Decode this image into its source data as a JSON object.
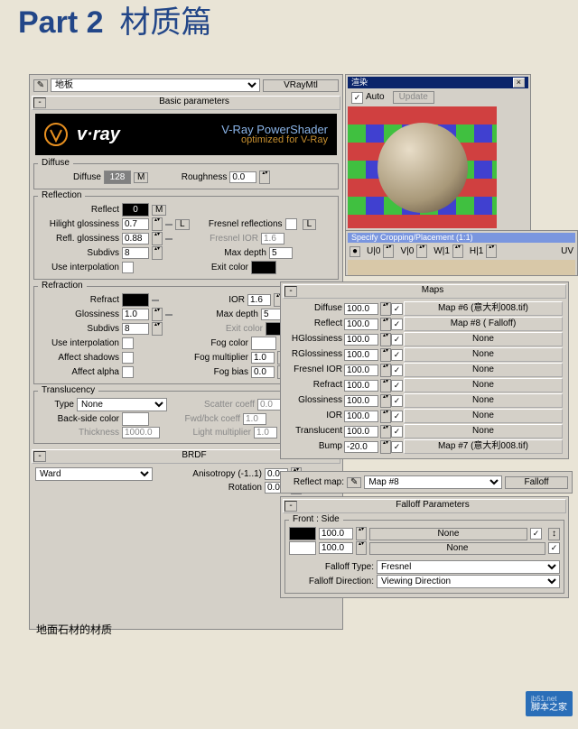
{
  "heading": {
    "p1": "Part 2",
    "p2": "材质篇"
  },
  "topbar": {
    "mat_name": "地板",
    "mtl_type": "VRayMtl"
  },
  "sections": {
    "basic": "Basic parameters",
    "brdf": "BRDF",
    "maps": "Maps",
    "falloff": "Falloff Parameters"
  },
  "vray": {
    "title": "V-Ray PowerShader",
    "subtitle": "optimized for V-Ray"
  },
  "diffuse": {
    "legend": "Diffuse",
    "label": "Diffuse",
    "val": "128",
    "m": "M",
    "rough_label": "Roughness",
    "rough": "0.0"
  },
  "reflection": {
    "legend": "Reflection",
    "reflect": "Reflect",
    "reflect_val": "0",
    "m": "M",
    "hilight": "Hilight glossiness",
    "hilight_val": "0.7",
    "l": "L",
    "refl_gloss": "Refl. glossiness",
    "refl_gloss_val": "0.88",
    "l2": "L",
    "subdivs": "Subdivs",
    "subdivs_val": "8",
    "use_interp": "Use interpolation",
    "fresnel": "Fresnel reflections",
    "fresnel_ior": "Fresnel IOR",
    "fresnel_ior_val": "1.6",
    "maxdepth": "Max depth",
    "maxdepth_val": "5",
    "exit": "Exit color"
  },
  "refraction": {
    "legend": "Refraction",
    "refract": "Refract",
    "ior": "IOR",
    "ior_val": "1.6",
    "gloss": "Glossiness",
    "gloss_val": "1.0",
    "maxdepth": "Max depth",
    "maxdepth_val": "5",
    "subdivs": "Subdivs",
    "subdivs_val": "8",
    "exit": "Exit color",
    "use_interp": "Use interpolation",
    "fog": "Fog color",
    "aff_sh": "Affect shadows",
    "fog_mult": "Fog multiplier",
    "fog_mult_val": "1.0",
    "aff_a": "Affect alpha",
    "fog_bias": "Fog bias",
    "fog_bias_val": "0.0"
  },
  "transl": {
    "legend": "Translucency",
    "type": "Type",
    "type_val": "None",
    "scatter": "Scatter coeff",
    "scatter_val": "0.0",
    "back": "Back-side color",
    "fwd": "Fwd/bck coeff",
    "fwd_val": "1.0",
    "thick": "Thickness",
    "thick_val": "1000.0",
    "light": "Light multiplier",
    "light_val": "1.0"
  },
  "brdf": {
    "type": "Ward",
    "aniso": "Anisotropy (-1..1)",
    "aniso_val": "0.0",
    "rot": "Rotation",
    "rot_val": "0.0"
  },
  "maps": [
    {
      "n": "Diffuse",
      "v": "100.0",
      "c": true,
      "m": "Map #6 (意大利008.tif)"
    },
    {
      "n": "Reflect",
      "v": "100.0",
      "c": true,
      "m": "Map #8   ( Falloff)"
    },
    {
      "n": "HGlossiness",
      "v": "100.0",
      "c": true,
      "m": "None"
    },
    {
      "n": "RGlossiness",
      "v": "100.0",
      "c": true,
      "m": "None"
    },
    {
      "n": "Fresnel IOR",
      "v": "100.0",
      "c": true,
      "m": "None"
    },
    {
      "n": "Refract",
      "v": "100.0",
      "c": true,
      "m": "None"
    },
    {
      "n": "Glossiness",
      "v": "100.0",
      "c": true,
      "m": "None"
    },
    {
      "n": "IOR",
      "v": "100.0",
      "c": true,
      "m": "None"
    },
    {
      "n": "Translucent",
      "v": "100.0",
      "c": true,
      "m": "None"
    },
    {
      "n": "Bump",
      "v": "-20.0",
      "c": true,
      "m": "Map #7 (意大利008.tif)"
    }
  ],
  "reflmap": {
    "label": "Reflect map:",
    "val": "Map #8",
    "type": "Falloff"
  },
  "falloff": {
    "legend": "Front : Side",
    "rows": [
      {
        "v": "100.0",
        "m": "None"
      },
      {
        "v": "100.0",
        "m": "None"
      }
    ],
    "type_l": "Falloff Type:",
    "type_v": "Fresnel",
    "dir_l": "Falloff Direction:",
    "dir_v": "Viewing Direction"
  },
  "preview": {
    "auto": "Auto",
    "update": "Update",
    "crop_title": "Specify Cropping/Placement (1:1)",
    "uv": "UV"
  },
  "footnote": "地面石材的材质",
  "watermark": "脚本之家"
}
